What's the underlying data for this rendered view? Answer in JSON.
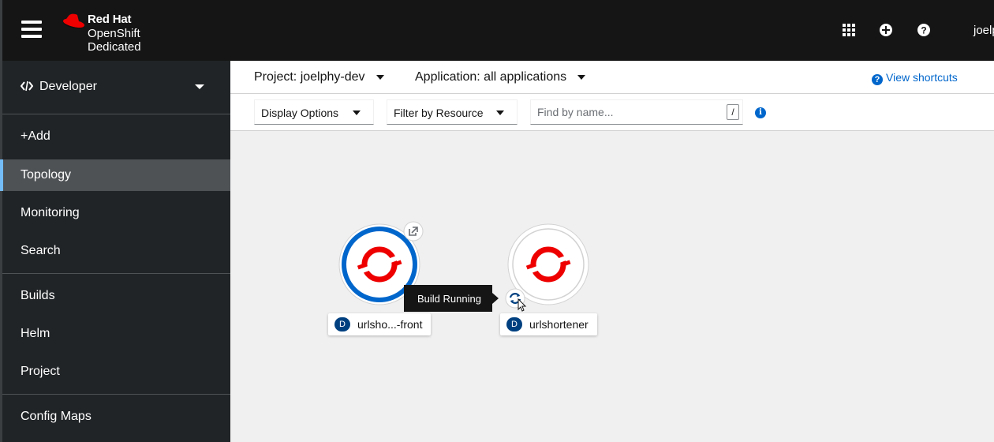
{
  "masthead": {
    "brand_line1": "Red Hat",
    "brand_line2": "OpenShift",
    "brand_line3": "Dedicated",
    "user": "joelphy",
    "icons": [
      "menu-icon",
      "app-launcher-icon",
      "add-icon",
      "help-icon"
    ]
  },
  "sidebar": {
    "perspective": "Developer",
    "items": [
      {
        "label": "+Add"
      },
      {
        "label": "Topology",
        "active": true
      },
      {
        "label": "Monitoring"
      },
      {
        "label": "Search"
      },
      {
        "label": "Builds"
      },
      {
        "label": "Helm"
      },
      {
        "label": "Project"
      },
      {
        "label": "Config Maps"
      }
    ]
  },
  "toolbar": {
    "project": "Project: joelphy-dev",
    "application": "Application: all applications",
    "shortcuts": "View shortcuts",
    "display_options": "Display Options",
    "filter_by_resource": "Filter by Resource",
    "find_placeholder": "Find by name...",
    "find_shortcut": "/"
  },
  "topology": {
    "nodes": [
      {
        "kind": "D",
        "name": "urlsho...-front",
        "status": "running"
      },
      {
        "kind": "D",
        "name": "urlshortener",
        "status": "build-running"
      }
    ],
    "tooltip": "Build Running"
  },
  "colors": {
    "masthead": "#151515",
    "sidebar": "#212427",
    "accent": "#0066cc",
    "openshift_red": "#ee0000",
    "pod_ring": "#0066cc"
  }
}
